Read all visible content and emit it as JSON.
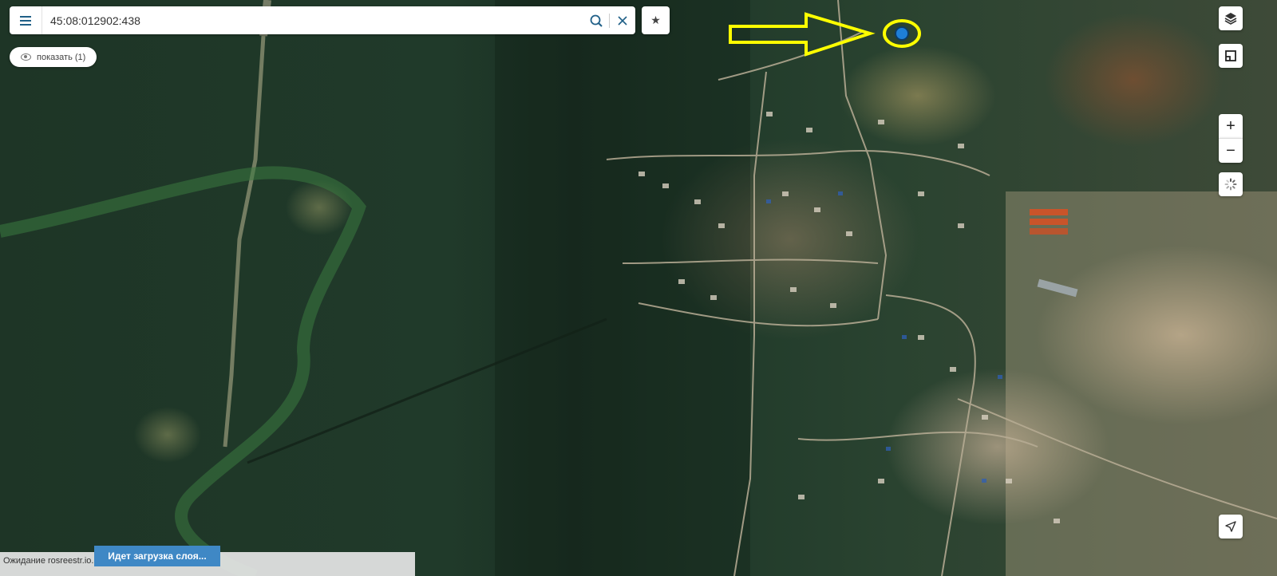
{
  "search": {
    "query": "45:08:012902:438"
  },
  "filters": {
    "show_label": "показать (1)"
  },
  "controls": {
    "zoom_in": "+",
    "zoom_out": "−"
  },
  "status": {
    "text": "Ожидание rosreestr.io...",
    "loading_label": "Идет загрузка слоя..."
  },
  "colors": {
    "accent": "#1f5f87",
    "annotation": "#ffff00",
    "marker": "#1e7fd8",
    "loading": "#3f88c5"
  },
  "icons": [
    "menu-icon",
    "search-icon",
    "clear-icon",
    "star-icon",
    "eye-icon",
    "layers-icon",
    "ruler-icon",
    "spinner-icon",
    "location-arrow-icon"
  ]
}
